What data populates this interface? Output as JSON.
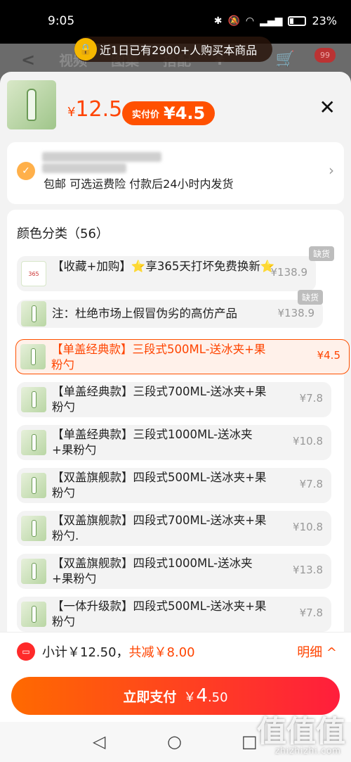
{
  "status_bar": {
    "time": "9:05",
    "battery": "23%"
  },
  "background": {
    "back_icon": "<",
    "tabs": [
      "视频",
      "图集",
      "搭配",
      "¥"
    ],
    "cart_icon": "cart",
    "badge": "99"
  },
  "toast": {
    "text": "近1日已有2900+人购买本商品"
  },
  "product": {
    "price_currency": "¥",
    "price": "12.5",
    "real_price_label": "实付价",
    "real_price": "¥4.5",
    "close_icon": "✕"
  },
  "shipping": {
    "description": "包邮  可选运费险  付款后24小时内发货"
  },
  "sku": {
    "title": "颜色分类（56）",
    "items": [
      {
        "label": "【收藏+加购】⭐享365天打坏免费换新⭐",
        "price": "¥138.9",
        "tag": "缺货"
      },
      {
        "label": "注：杜绝市场上假冒伪劣的高仿产品",
        "price": "¥138.9",
        "tag": "缺货"
      },
      {
        "label": "【单盖经典款】三段式500ML-送冰夹+果粉勺",
        "price": "¥4.5",
        "tag": ""
      },
      {
        "label": "【单盖经典款】三段式700ML-送冰夹+果粉勺",
        "price": "¥7.8",
        "tag": ""
      },
      {
        "label": "【单盖经典款】三段式1000ML-送冰夹+果粉勺",
        "price": "¥10.8",
        "tag": ""
      },
      {
        "label": "【双盖旗舰款】四段式500ML-送冰夹+果粉勺",
        "price": "¥7.8",
        "tag": ""
      },
      {
        "label": "【双盖旗舰款】四段式700ML-送冰夹+果粉勺.",
        "price": "¥10.8",
        "tag": ""
      },
      {
        "label": "【双盖旗舰款】四段式1000ML-送冰夹+果粉勺",
        "price": "¥13.8",
        "tag": ""
      },
      {
        "label": "【一体升级款】四段式500ML-送冰夹+果粉勺",
        "price": "¥7.8",
        "tag": ""
      }
    ]
  },
  "summary": {
    "subtotal_label": "小计￥12.50，",
    "discount_label": "共减￥8.00",
    "detail_link": "明细 ^"
  },
  "pay": {
    "button_label": "立即支付",
    "currency": "￥",
    "amount_int": "4",
    "amount_dec": ".50"
  },
  "watermark": {
    "text": "值值值",
    "sub": "zhizhizhi.com"
  },
  "colors": {
    "accent": "#ff5000",
    "price_red": "#ff4400",
    "pay_gradient_start": "#ff6a00",
    "pay_gradient_end": "#ff1e3c"
  }
}
